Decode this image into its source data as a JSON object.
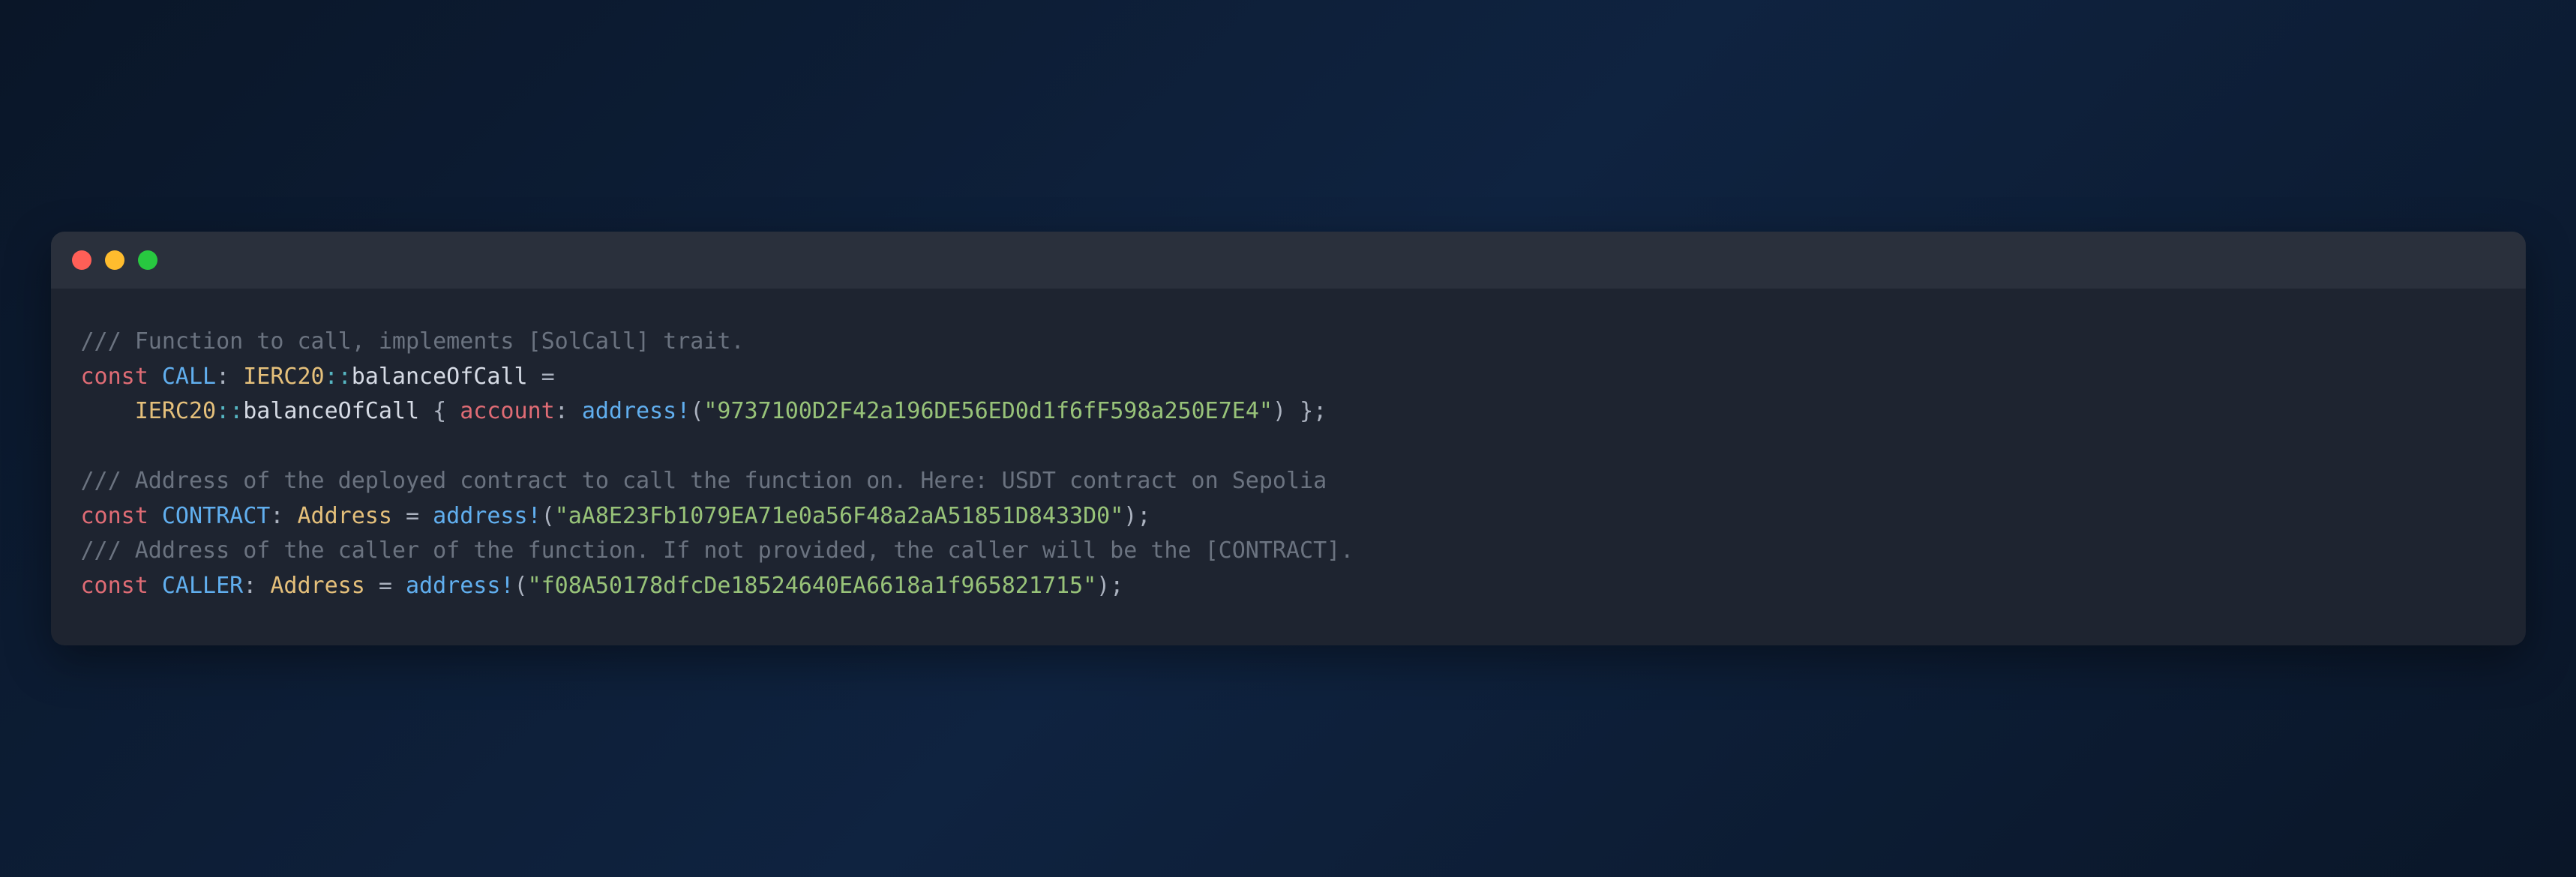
{
  "colors": {
    "red": "#ff5f57",
    "yellow": "#febc2e",
    "green": "#28c840"
  },
  "code": {
    "comment1": "/// Function to call, implements [SolCall] trait.",
    "kw_const": "const",
    "call_name": "CALL",
    "ierc20": "IERC20",
    "dcolon": "::",
    "balanceOfCall": "balanceOfCall",
    "eq": " = ",
    "lbrace": " { ",
    "rbrace": " }",
    "account_field": "account",
    "colon": ": ",
    "address_macro": "address!",
    "lparen": "(",
    "rparen": ")",
    "semi": ";",
    "string_account": "\"9737100D2F42a196DE56ED0d1f6fF598a250E7E4\"",
    "comment2": "/// Address of the deployed contract to call the function on. Here: USDT contract on Sepolia",
    "contract_name": "CONTRACT",
    "address_type": "Address",
    "string_contract": "\"aA8E23Fb1079EA71e0a56F48a2aA51851D8433D0\"",
    "comment3": "/// Address of the caller of the function. If not provided, the caller will be the [CONTRACT].",
    "caller_name": "CALLER",
    "string_caller": "\"f08A50178dfcDe18524640EA6618a1f965821715\"",
    "indent": "    "
  }
}
